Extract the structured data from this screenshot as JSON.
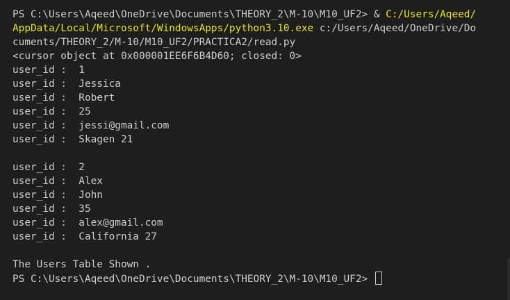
{
  "terminal": {
    "command": {
      "prompt": "PS C:\\Users\\Aqeed\\OneDrive\\Documents\\THEORY_2\\M-10\\M10_UF2> ",
      "amp": "& ",
      "exe_part1": "C:/Users/Aqeed/",
      "exe_part2": "AppData/Local/Microsoft/WindowsApps/python3.10.exe",
      "arg_part1": " c:/Users/Aqeed/OneDrive/Do",
      "arg_part2": "cuments/THEORY_2/M-10/M10_UF2/PRACTICA2/read.py"
    },
    "cursor_line": "<cursor object at 0x000001EE6F6B4D60; closed: 0>",
    "record1": [
      "user_id :  1",
      "user_id :  Jessica",
      "user_id :  Robert",
      "user_id :  25",
      "user_id :  jessi@gmail.com",
      "user_id :  Skagen 21"
    ],
    "record2": [
      "user_id :  2",
      "user_id :  Alex",
      "user_id :  John",
      "user_id :  35",
      "user_id :  alex@gmail.com",
      "user_id :  California 27"
    ],
    "footer": "The Users Table Shown .",
    "final_prompt": "PS C:\\Users\\Aqeed\\OneDrive\\Documents\\THEORY_2\\M-10\\M10_UF2> "
  },
  "colors": {
    "background": "#1e1e1e",
    "text": "#cccccc",
    "highlight": "#e5e510"
  }
}
